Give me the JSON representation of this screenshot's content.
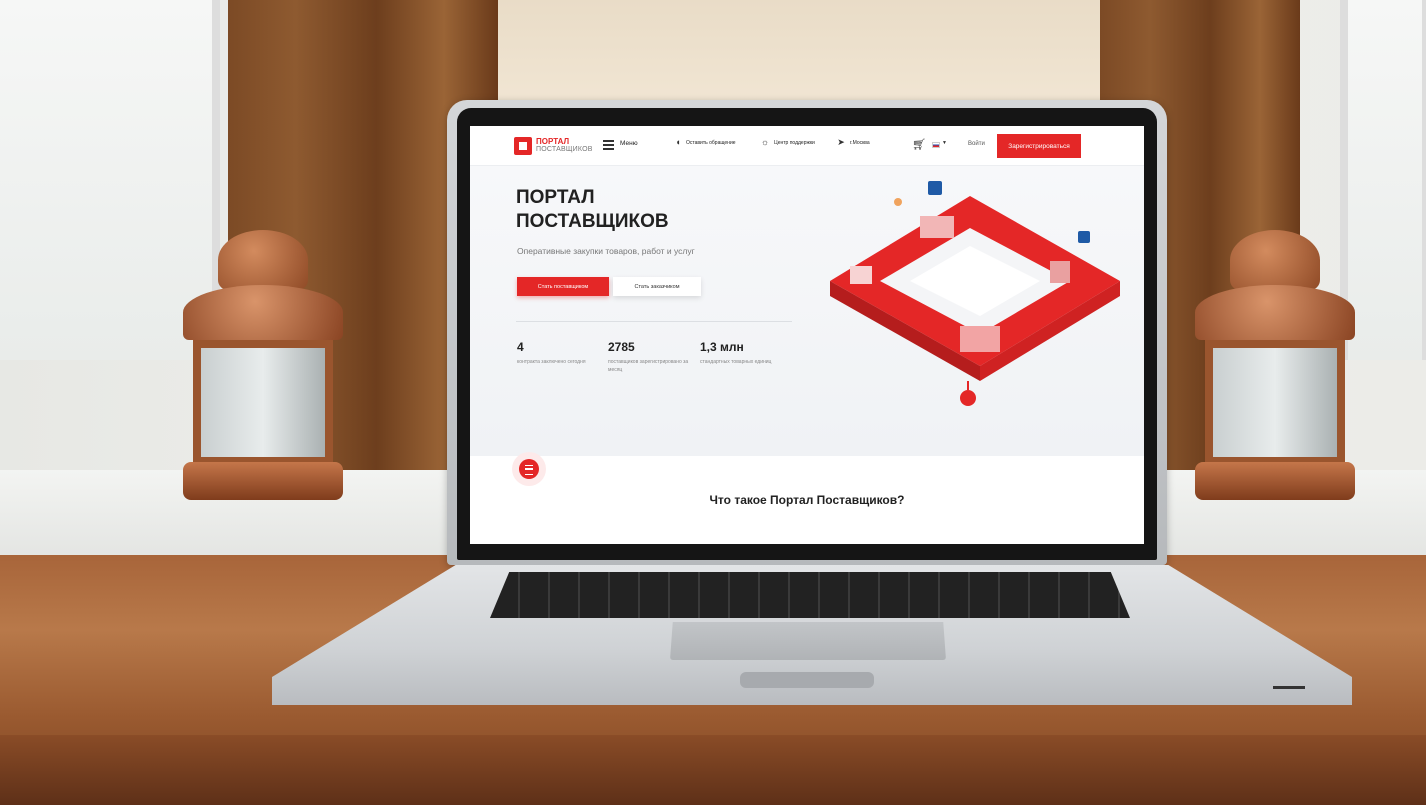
{
  "header": {
    "logo_line1": "ПОРТАЛ",
    "logo_line2": "ПОСТАВЩИКОВ",
    "menu_label": "Меню",
    "feedback_label": "Оставить обращение",
    "support_label": "Центр поддержки",
    "region_label": "г.Москва",
    "login_label": "Войти",
    "register_label": "Зарегистрироваться"
  },
  "hero": {
    "title": "ПОРТАЛ\nПОСТАВЩИКОВ",
    "subtitle": "Оперативные закупки товаров, работ и услуг",
    "primary_button": "Стать поставщиком",
    "secondary_button": "Стать заказчиком",
    "stats": [
      {
        "value": "4",
        "label": "контракта заключено сегодня"
      },
      {
        "value": "2785",
        "label": "поставщиков зарегистрировано за месяц"
      },
      {
        "value": "1,3 млн",
        "label": "стандартных товарных единиц"
      }
    ]
  },
  "section": {
    "title": "Что такое Портал Поставщиков?"
  },
  "icons": {
    "menu": "hamburger-icon",
    "feedback": "headset-icon",
    "support": "lightbulb-icon",
    "region": "location-arrow-icon",
    "cart": "cart-icon",
    "language": "flag-ru-icon",
    "fab": "chat-icon"
  },
  "colors": {
    "accent": "#e42727",
    "text": "#212121",
    "muted": "#888888"
  }
}
